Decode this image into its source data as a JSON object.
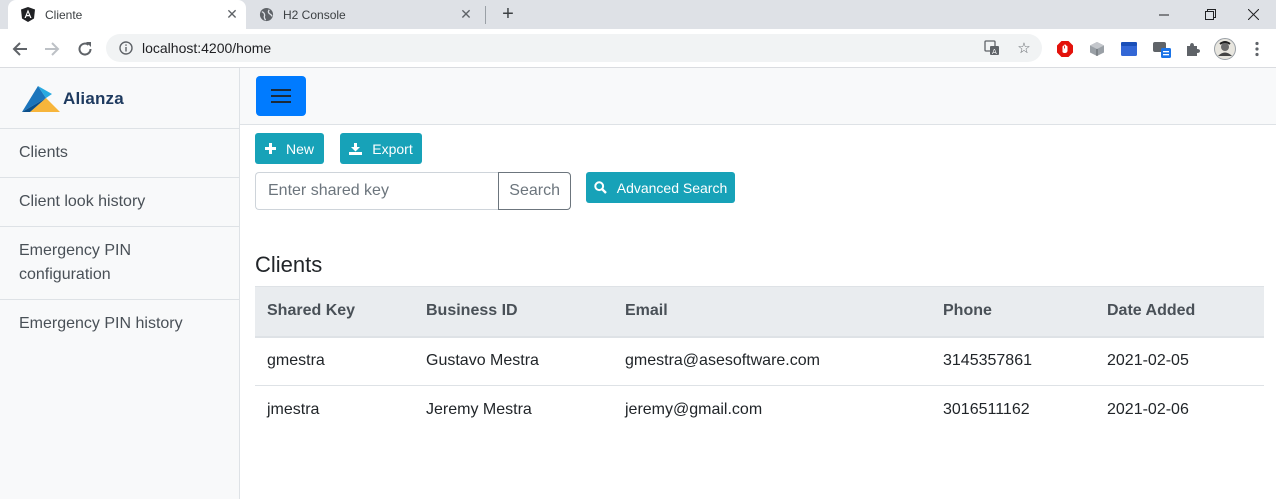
{
  "browser": {
    "tabs": [
      {
        "title": "Cliente",
        "icon": "angular-icon",
        "active": true
      },
      {
        "title": "H2 Console",
        "icon": "globe-icon",
        "active": false
      }
    ],
    "url": "localhost:4200/home"
  },
  "sidebar": {
    "brand": "Alianza",
    "items": [
      {
        "label": "Clients"
      },
      {
        "label": "Client look history"
      },
      {
        "label": "Emergency PIN configuration"
      },
      {
        "label": "Emergency PIN history"
      }
    ]
  },
  "actions": {
    "new_label": "New",
    "export_label": "Export",
    "search_placeholder": "Enter shared key",
    "search_label": "Search",
    "advanced_search_label": "Advanced Search"
  },
  "clients": {
    "title": "Clients",
    "columns": [
      "Shared Key",
      "Business ID",
      "Email",
      "Phone",
      "Date Added"
    ],
    "rows": [
      [
        "gmestra",
        "Gustavo Mestra",
        "gmestra@asesoftware.com",
        "3145357861",
        "2021-02-05"
      ],
      [
        "jmestra",
        "Jeremy Mestra",
        "jeremy@gmail.com",
        "3016511162",
        "2021-02-06"
      ]
    ]
  },
  "colors": {
    "primary": "#007bff",
    "info": "#17a2b8",
    "sidebar_bg": "#f8f9fa",
    "table_header_bg": "#e9ecef"
  }
}
